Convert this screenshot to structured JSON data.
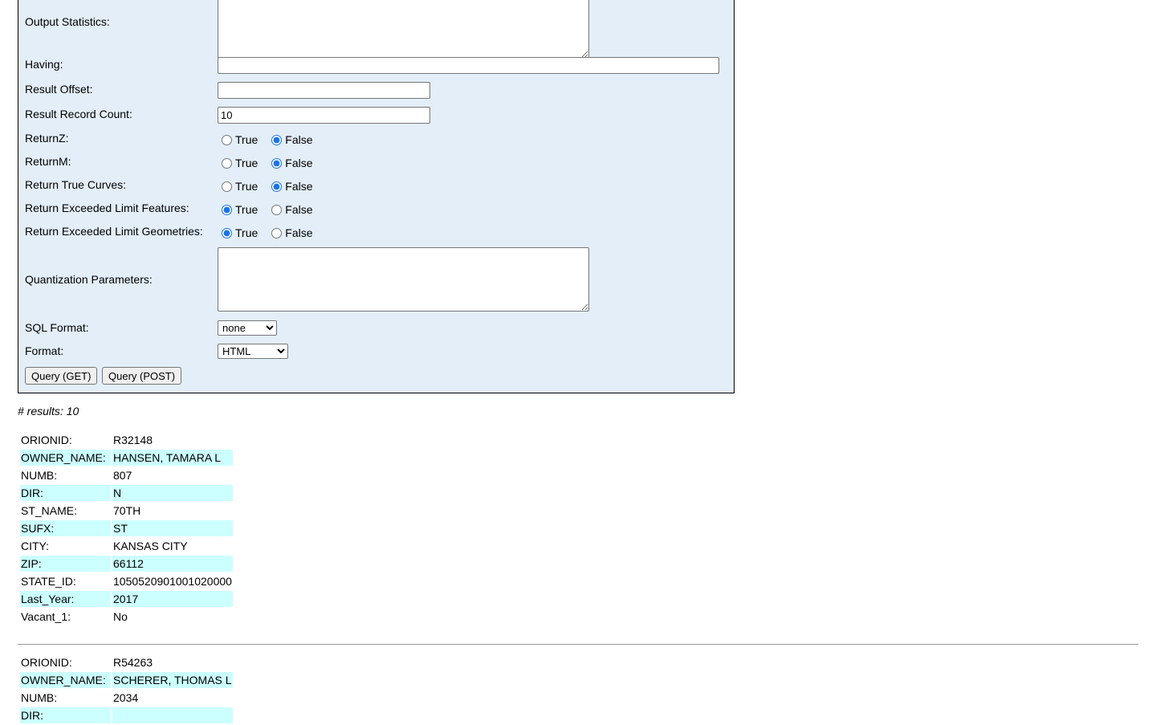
{
  "form": {
    "output_statistics": {
      "label": "Output Statistics:",
      "value": ""
    },
    "having": {
      "label": "Having:",
      "value": ""
    },
    "result_offset": {
      "label": "Result Offset:",
      "value": ""
    },
    "result_record_count": {
      "label": "Result Record Count:",
      "value": "10"
    },
    "radio_true_label": "True",
    "radio_false_label": "False",
    "returnz": {
      "label": "ReturnZ:",
      "selected": "False"
    },
    "returnm": {
      "label": "ReturnM:",
      "selected": "False"
    },
    "return_true_curves": {
      "label": "Return True Curves:",
      "selected": "False"
    },
    "return_exceeded_limit_features": {
      "label": "Return Exceeded Limit Features:",
      "selected": "True"
    },
    "return_exceeded_limit_geometries": {
      "label": "Return Exceeded Limit Geometries:",
      "selected": "True"
    },
    "quantization_parameters": {
      "label": "Quantization Parameters:",
      "value": ""
    },
    "sql_format": {
      "label": "SQL Format:",
      "selected": "none"
    },
    "format": {
      "label": "Format:",
      "selected": "HTML"
    },
    "query_get_label": "Query (GET)",
    "query_post_label": "Query (POST)"
  },
  "results": {
    "count_text": "# results: 10",
    "records": [
      [
        [
          "ORIONID:",
          "R32148"
        ],
        [
          "OWNER_NAME:",
          "HANSEN, TAMARA L"
        ],
        [
          "NUMB:",
          "807"
        ],
        [
          "DIR:",
          "N"
        ],
        [
          "ST_NAME:",
          "70TH"
        ],
        [
          "SUFX:",
          "ST"
        ],
        [
          "CITY:",
          "KANSAS CITY"
        ],
        [
          "ZIP:",
          "66112"
        ],
        [
          "STATE_ID:",
          "1050520901001020000"
        ],
        [
          "Last_Year:",
          "2017"
        ],
        [
          "Vacant_1:",
          "No"
        ]
      ],
      [
        [
          "ORIONID:",
          "R54263"
        ],
        [
          "OWNER_NAME:",
          "SCHERER, THOMAS L"
        ],
        [
          "NUMB:",
          "2034"
        ],
        [
          "DIR:",
          ""
        ]
      ]
    ]
  }
}
